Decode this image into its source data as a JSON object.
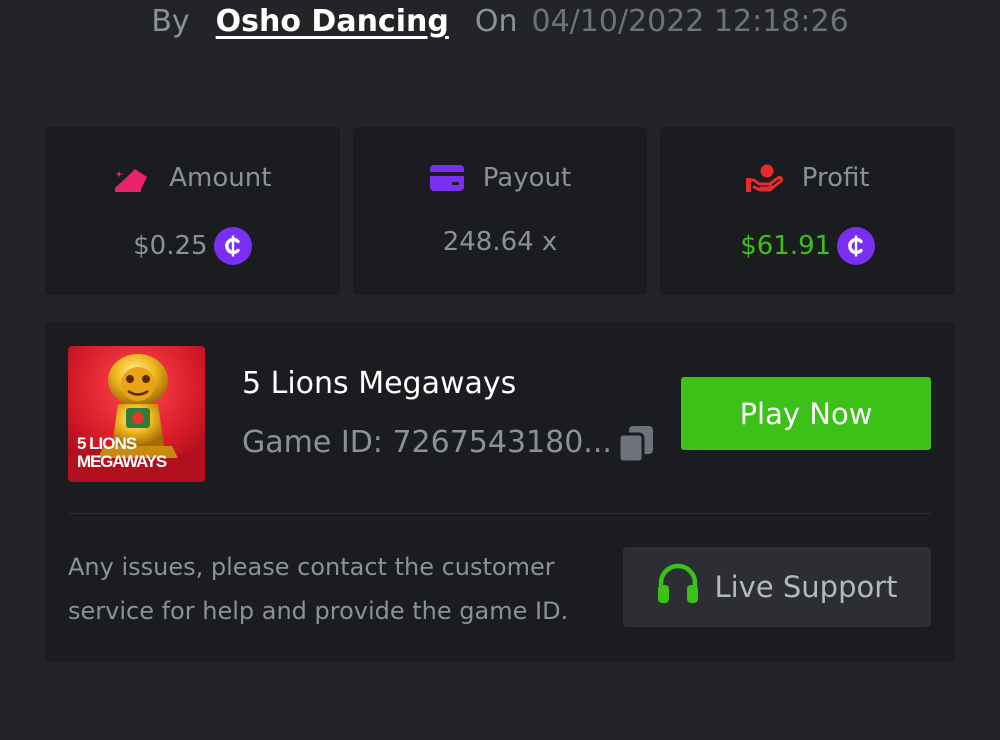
{
  "header": {
    "by_label": "By",
    "author": "Osho Dancing",
    "on_label": "On",
    "datetime": "04/10/2022 12:18:26"
  },
  "stats": {
    "amount": {
      "label": "Amount",
      "value": "$0.25",
      "icon": "bet-chips-icon",
      "icon_color": "#e8246b"
    },
    "payout": {
      "label": "Payout",
      "value": "248.64 x",
      "icon": "credit-card-icon",
      "icon_color": "#7b2ff2"
    },
    "profit": {
      "label": "Profit",
      "value": "$61.91",
      "icon": "hand-coin-icon",
      "icon_color": "#e82b2b",
      "value_color": "#3bc117"
    }
  },
  "game": {
    "name": "5 Lions Megaways",
    "id_text": "Game ID: 7267543180...",
    "thumbnail_title_line1": "5 LIONS",
    "thumbnail_title_line2": "MEGAWAYS",
    "play_label": "Play Now"
  },
  "support": {
    "help_text": "Any issues, please contact the customer service for help and provide the game ID.",
    "button_label": "Live Support"
  },
  "colors": {
    "background": "#232427",
    "card": "#1b1c1f",
    "accent_green": "#3bc117",
    "coin_purple": "#7b2ff2",
    "muted_text": "#8b9099"
  }
}
